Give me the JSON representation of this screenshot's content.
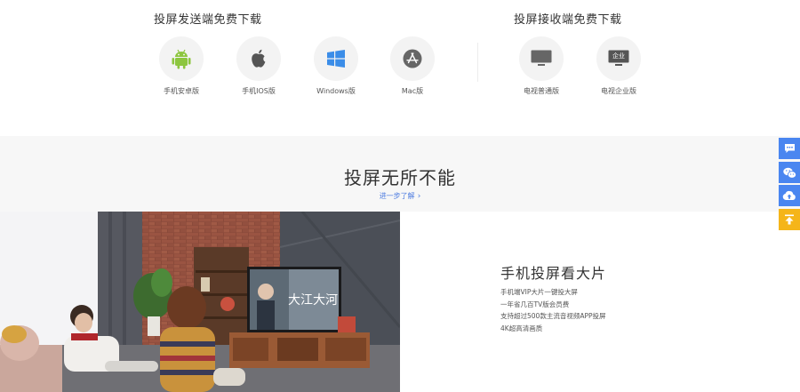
{
  "download": {
    "send_title": "投屏发送端免费下载",
    "receive_title": "投屏接收端免费下载",
    "send_items": [
      {
        "label": "手机安卓版",
        "icon": "android-icon"
      },
      {
        "label": "手机IOS版",
        "icon": "apple-icon"
      },
      {
        "label": "Windows版",
        "icon": "windows-icon"
      },
      {
        "label": "Mac版",
        "icon": "app-store-icon"
      }
    ],
    "receive_items": [
      {
        "label": "电视普通版",
        "icon": "tv-icon"
      },
      {
        "label": "电视企业版",
        "icon": "tv-enterprise-icon",
        "badge": "企业"
      }
    ]
  },
  "feature": {
    "title": "投屏无所不能",
    "more_label": "进一步了解",
    "more_chevron": "›",
    "card": {
      "tv_show_title": "大江大河",
      "title": "手机投屏看大片",
      "points": [
        "手机端VIP大片一键投大屏",
        "一年省几百TV版会员费",
        "支持超过500款主流音视频APP投屏",
        "4K超高清画质"
      ]
    }
  },
  "floating_bar": [
    {
      "icon": "chat-icon"
    },
    {
      "icon": "wechat-icon"
    },
    {
      "icon": "cloud-upload-icon"
    },
    {
      "icon": "back-to-top-icon"
    }
  ],
  "colors": {
    "accent_blue": "#4a86f0",
    "accent_yellow": "#f5b519",
    "android_green": "#8dc63f",
    "link_blue": "#4f7de0"
  }
}
